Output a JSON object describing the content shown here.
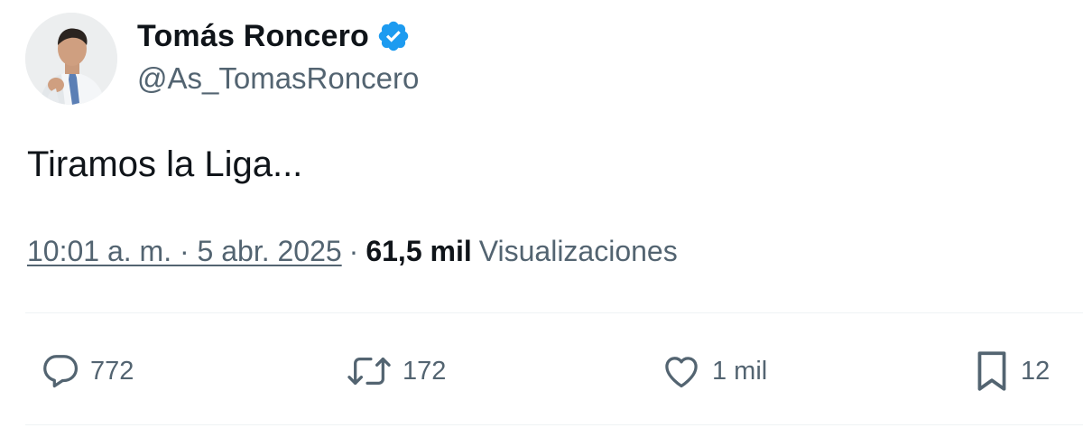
{
  "author": {
    "display_name": "Tomás Roncero",
    "handle": "@As_TomasRoncero",
    "verified": true
  },
  "tweet": {
    "text": "Tiramos la Liga..."
  },
  "meta": {
    "timestamp": "10:01 a. m. · 5 abr. 2025",
    "separator": "·",
    "views_count": "61,5 mil",
    "views_label": "Visualizaciones"
  },
  "actions": {
    "replies": "772",
    "retweets": "172",
    "likes": "1 mil",
    "bookmarks": "12"
  },
  "icons": {
    "verified": "verified-badge-icon",
    "reply": "reply-icon",
    "retweet": "retweet-icon",
    "like": "heart-icon",
    "bookmark": "bookmark-icon"
  },
  "colors": {
    "verified_blue": "#1d9bf0",
    "text_primary": "#0f1419",
    "text_secondary": "#536471"
  }
}
